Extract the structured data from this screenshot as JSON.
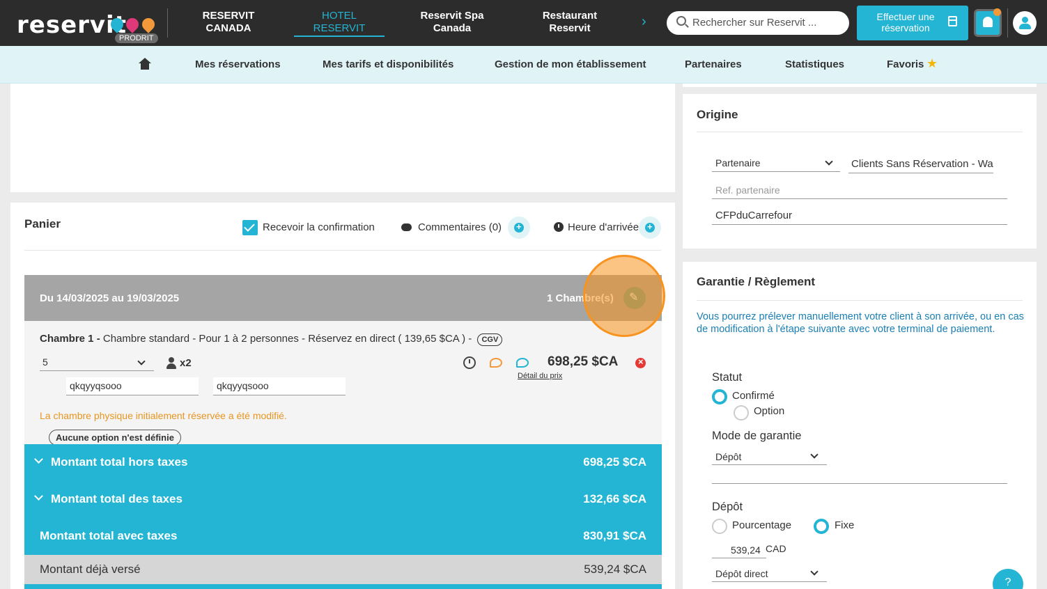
{
  "brand": {
    "logo_text": "reservit",
    "badge": "PRODRIT",
    "colors": {
      "accent": "#23b5d3",
      "dark": "#2c2c2c",
      "highlight": "#f7931e",
      "warning": "#e8951f",
      "danger": "#e53935"
    }
  },
  "topnav": {
    "items": [
      {
        "label1": "RESERVIT",
        "label2": "CANADA"
      },
      {
        "label1": "HOTEL",
        "label2": "RESERVIT"
      },
      {
        "label1": "Reservit Spa",
        "label2": "Canada"
      },
      {
        "label1": "Restaurant",
        "label2": "Reservit"
      }
    ],
    "active_index": 1,
    "next_icon": "chevron-right-icon",
    "search_placeholder": "Rechercher sur Reservit ...",
    "book_button": {
      "line1": "Effectuer une",
      "line2": "réservation"
    }
  },
  "subnav": {
    "items": [
      "Mes réservations",
      "Mes tarifs et disponibilités",
      "Gestion de mon établissement",
      "Partenaires",
      "Statistiques",
      "Favoris"
    ]
  },
  "panier": {
    "title": "Panier",
    "receive_confirmation": "Recevoir la confirmation",
    "comments": "Commentaires (0)",
    "arrival_time": "Heure d'arrivée",
    "stay": {
      "dates": "Du 14/03/2025 au 19/03/2025",
      "rooms": "1 Chambre(s)"
    },
    "room": {
      "prefix": "Chambre 1 -",
      "description": " Chambre standard - Pour 1 à 2 personnes - Réservez en direct ( 139,65 $CA ) - ",
      "cgv": "CGV",
      "quantity": "5",
      "persons": "x2",
      "price": "698,25 $CA",
      "price_detail": "Détail du prix",
      "guest1": "qkqyyqsooo",
      "guest2": "qkqyyqsooo",
      "warning": "La chambre physique initialement réservée a été modifié.",
      "no_option": "Aucune option n'est définie"
    },
    "totals": [
      {
        "label": "Montant total hors taxes",
        "value": "698,25 $CA"
      },
      {
        "label": "Montant total des taxes",
        "value": "132,66 $CA"
      },
      {
        "label": "Montant total avec taxes",
        "value": "830,91 $CA"
      }
    ],
    "paid": {
      "label": "Montant déjà versé",
      "value": "539,24 $CA"
    }
  },
  "origine": {
    "title": "Origine",
    "source_select": "Partenaire",
    "partner_value": "Clients Sans Réservation - Wa",
    "ref_placeholder": "Ref. partenaire",
    "code_value": "CFPduCarrefour"
  },
  "garantie": {
    "title": "Garantie / Règlement",
    "info": "Vous pourrez prélever manuellement votre client à son arrivée, ou en cas de modification à l'étape suivante avec votre terminal de paiement.",
    "statut_label": "Statut",
    "statut_options": [
      "Confirmé",
      "Option"
    ],
    "statut_selected": "Confirmé",
    "mode_label": "Mode de garantie",
    "mode_value": "Dépôt",
    "depot_label": "Dépôt",
    "depot_options": [
      "Pourcentage",
      "Fixe"
    ],
    "depot_selected": "Fixe",
    "depot_amount": "539,24",
    "depot_currency": "CAD",
    "depot_type": "Dépôt direct"
  },
  "help_label": "?"
}
